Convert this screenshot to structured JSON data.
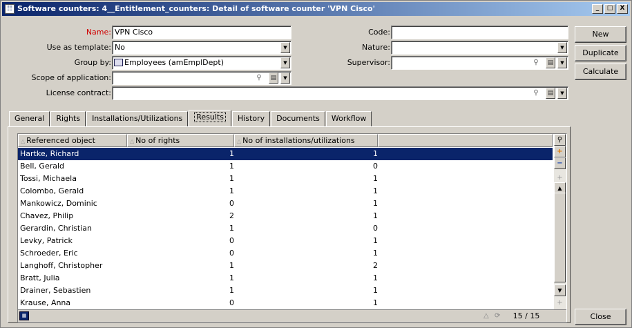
{
  "window": {
    "title": "Software counters: 4__Entitlement_counters: Detail of software counter 'VPN Cisco'",
    "icon": "window-app-icon",
    "controls": [
      "_",
      "□",
      "X"
    ]
  },
  "form": {
    "name_label": "Name:",
    "name_value": "VPN Cisco",
    "template_label": "Use as template:",
    "template_value": "No",
    "groupby_label": "Group by:",
    "groupby_value": "Employees (amEmplDept)",
    "scope_label": "Scope of application:",
    "scope_value": "",
    "license_label": "License contract:",
    "license_value": "",
    "code_label": "Code:",
    "code_value": "",
    "nature_label": "Nature:",
    "nature_value": "",
    "supervisor_label": "Supervisor:",
    "supervisor_value": ""
  },
  "buttons": {
    "new": "New",
    "duplicate": "Duplicate",
    "calculate": "Calculate",
    "close": "Close"
  },
  "tabs": [
    "General",
    "Rights",
    "Installations/Utilizations",
    "Results",
    "History",
    "Documents",
    "Workflow"
  ],
  "active_tab": "Results",
  "grid": {
    "headers": [
      "Referenced object",
      "No of rights",
      "No of installations/utilizations"
    ],
    "rows": [
      {
        "object": "Hartke, Richard",
        "rights": "1",
        "installs": "1"
      },
      {
        "object": "Bell, Gerald",
        "rights": "1",
        "installs": "0"
      },
      {
        "object": "Tossi, Michaela",
        "rights": "1",
        "installs": "1"
      },
      {
        "object": "Colombo, Gerald",
        "rights": "1",
        "installs": "1"
      },
      {
        "object": "Mankowicz, Dominic",
        "rights": "0",
        "installs": "1"
      },
      {
        "object": "Chavez, Philip",
        "rights": "2",
        "installs": "1"
      },
      {
        "object": "Gerardin, Christian",
        "rights": "1",
        "installs": "0"
      },
      {
        "object": "Levky, Patrick",
        "rights": "0",
        "installs": "1"
      },
      {
        "object": "Schroeder, Eric",
        "rights": "0",
        "installs": "1"
      },
      {
        "object": "Langhoff, Christopher",
        "rights": "1",
        "installs": "2"
      },
      {
        "object": "Bratt, Julia",
        "rights": "1",
        "installs": "1"
      },
      {
        "object": "Drainer, Sebastien",
        "rights": "1",
        "installs": "1"
      },
      {
        "object": "Krause, Anna",
        "rights": "0",
        "installs": "1"
      }
    ],
    "selected_index": 0,
    "count": "15 / 15"
  },
  "colors": {
    "window_bg": "#d4d0c8",
    "title_gradient_start": "#0a246a",
    "selection": "#0a246a",
    "required_label": "#d00000"
  }
}
